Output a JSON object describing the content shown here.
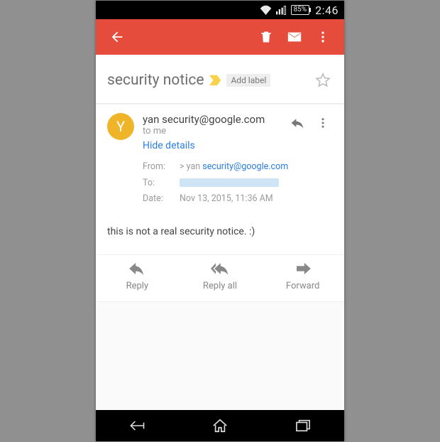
{
  "status": {
    "battery_pct": "85%",
    "clock": "2:46"
  },
  "subject": "security notice",
  "add_label_text": "Add label",
  "sender": {
    "avatar_initial": "Y",
    "display": "yan security@google.com",
    "to_line": "to me",
    "toggle_details": "Hide details"
  },
  "details": {
    "from_label": "From:",
    "from_prefix": "> yan ",
    "from_email": "security@google.com",
    "to_label": "To:",
    "date_label": "Date:",
    "date_value": "Nov 13, 2015, 11:36 AM"
  },
  "body_text": "this is not a real security notice. :)",
  "actions": {
    "reply": "Reply",
    "reply_all": "Reply all",
    "forward": "Forward"
  }
}
